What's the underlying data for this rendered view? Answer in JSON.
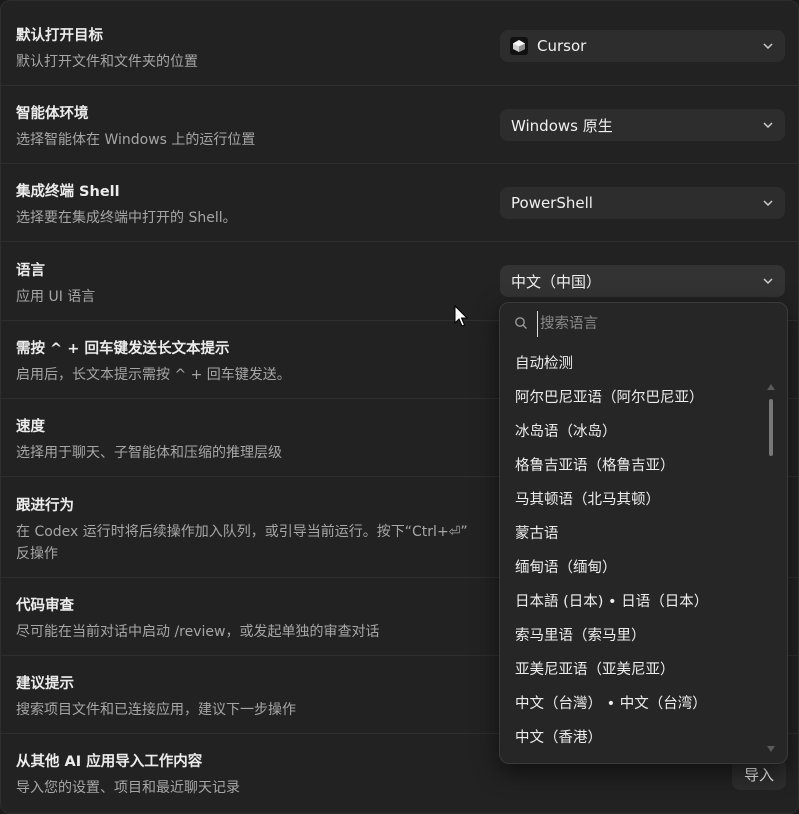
{
  "settings": [
    {
      "title": "默认打开目标",
      "desc": "默认打开文件和文件夹的位置",
      "control": "select",
      "value": "Cursor"
    },
    {
      "title": "智能体环境",
      "desc": "选择智能体在 Windows 上的运行位置",
      "control": "select",
      "value": "Windows 原生"
    },
    {
      "title": "集成终端 Shell",
      "desc": "选择要在集成终端中打开的 Shell。",
      "control": "select",
      "value": "PowerShell"
    },
    {
      "title": "语言",
      "desc": "应用 UI 语言",
      "control": "select",
      "value": "中文（中国）"
    },
    {
      "title": "需按 ^ + 回车键发送长文本提示",
      "desc": "启用后，长文本提示需按 ^ + 回车键发送。",
      "control": "toggle"
    },
    {
      "title": "速度",
      "desc": "选择用于聊天、子智能体和压缩的推理层级",
      "control": "select"
    },
    {
      "title": "跟进行为",
      "desc": "在 Codex 运行时将后续操作加入队列，或引导当前运行。按下“Ctrl+⏎”",
      "desc2": "反操作",
      "control": "segmented"
    },
    {
      "title": "代码审查",
      "desc": "尽可能在当前对话中启动 /review，或发起单独的审查对话",
      "control": "select"
    },
    {
      "title": "建议提示",
      "desc": "搜索项目文件和已连接应用，建议下一步操作",
      "control": "toggle"
    },
    {
      "title": "从其他 AI 应用导入工作内容",
      "desc": "导入您的设置、项目和最近聊天记录",
      "control": "button",
      "button_label": "导入"
    }
  ],
  "language_dropdown": {
    "search_placeholder": "搜索语言",
    "options": [
      "自动检测",
      "阿尔巴尼亚语（阿尔巴尼亚）",
      "冰岛语（冰岛）",
      "格鲁吉亚语（格鲁吉亚）",
      "马其顿语（北马其顿）",
      "蒙古语",
      "缅甸语（缅甸）",
      "日本語 (日本) • 日语（日本）",
      "索马里语（索马里）",
      "亚美尼亚语（亚美尼亚）",
      "中文（台灣） • 中文（台湾）",
      "中文（香港）"
    ]
  },
  "icons": {
    "select_chevron": "chevron-down-icon",
    "cursor_app": "cursor-logo-icon",
    "search": "search-icon",
    "pointer": "mouse-pointer-icon"
  },
  "colors": {
    "background": "#222222",
    "control": "#2d2d2d",
    "text": "#ececec",
    "muted": "#a6a6a6"
  }
}
